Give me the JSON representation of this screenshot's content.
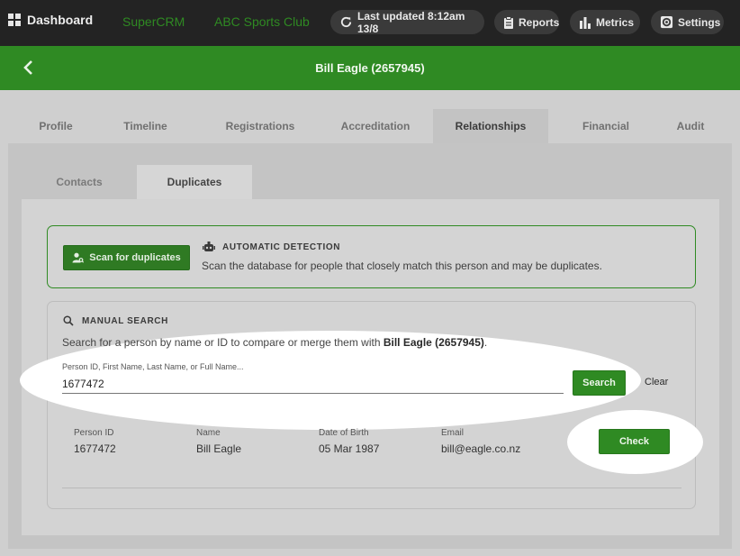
{
  "topbar": {
    "dashboard_label": "Dashboard",
    "brand1": "SuperCRM",
    "brand2": "ABC Sports Club",
    "last_updated": "Last updated 8:12am 13/8",
    "reports": "Reports",
    "metrics": "Metrics",
    "settings": "Settings"
  },
  "header": {
    "back_icon": "chevron-left-icon",
    "title": "Bill Eagle (2657945)"
  },
  "tabs": [
    "Profile",
    "Timeline",
    "Registrations",
    "Accreditation",
    "Relationships",
    "Financial",
    "Audit"
  ],
  "active_tab": "Relationships",
  "subtabs": [
    "Contacts",
    "Duplicates"
  ],
  "active_subtab": "Duplicates",
  "automatic": {
    "button": "Scan for duplicates",
    "heading": "AUTOMATIC DETECTION",
    "description": "Scan the database for people that closely match this person and may be duplicates."
  },
  "manual": {
    "heading": "MANUAL SEARCH",
    "desc_prefix": "Search for a person by name or ID to compare or merge them with ",
    "desc_name": "Bill Eagle (2657945)",
    "desc_suffix": ".",
    "input_label": "Person ID, First Name, Last Name, or Full Name...",
    "input_value": "1677472",
    "search_button": "Search",
    "clear_button": "Clear"
  },
  "result": {
    "person_id_label": "Person ID",
    "person_id": "1677472",
    "name_label": "Name",
    "name": "Bill Eagle",
    "dob_label": "Date of Birth",
    "dob": "05 Mar 1987",
    "email_label": "Email",
    "email": "bill@eagle.co.nz",
    "check_button": "Check"
  },
  "colors": {
    "brand_green": "#2f8a23",
    "topbar": "#232323",
    "overlay_gray": "#cfcfcf",
    "highlight": "#ffffff"
  }
}
